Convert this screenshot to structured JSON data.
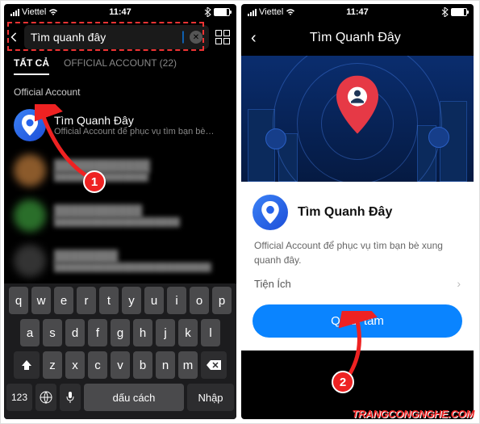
{
  "status": {
    "carrier": "Viettel",
    "time": "11:47"
  },
  "left": {
    "search_value": "Tìm quanh đây",
    "tabs": {
      "all": "TẤT CẢ",
      "official": "OFFICIAL ACCOUNT (22)"
    },
    "section_label": "Official Account",
    "result": {
      "title": "Tìm Quanh Đây",
      "subtitle": "Official Account để phục vụ tìm bạn bè xun..."
    },
    "keyboard": {
      "row1": [
        "q",
        "w",
        "e",
        "r",
        "t",
        "y",
        "u",
        "i",
        "o",
        "p"
      ],
      "row2": [
        "a",
        "s",
        "d",
        "f",
        "g",
        "h",
        "j",
        "k",
        "l"
      ],
      "row3": [
        "z",
        "x",
        "c",
        "v",
        "b",
        "n",
        "m"
      ],
      "num": "123",
      "space": "dấu cách",
      "enter": "Nhập"
    }
  },
  "right": {
    "header": "Tìm Quanh Đây",
    "title": "Tìm Quanh Đây",
    "description": "Official Account để phục vụ tìm bạn bè xung quanh đây.",
    "utility": "Tiện Ích",
    "follow": "Quan tâm"
  },
  "annotations": {
    "step1": "1",
    "step2": "2"
  },
  "watermark": "TRANGCONGNGHE.COM"
}
